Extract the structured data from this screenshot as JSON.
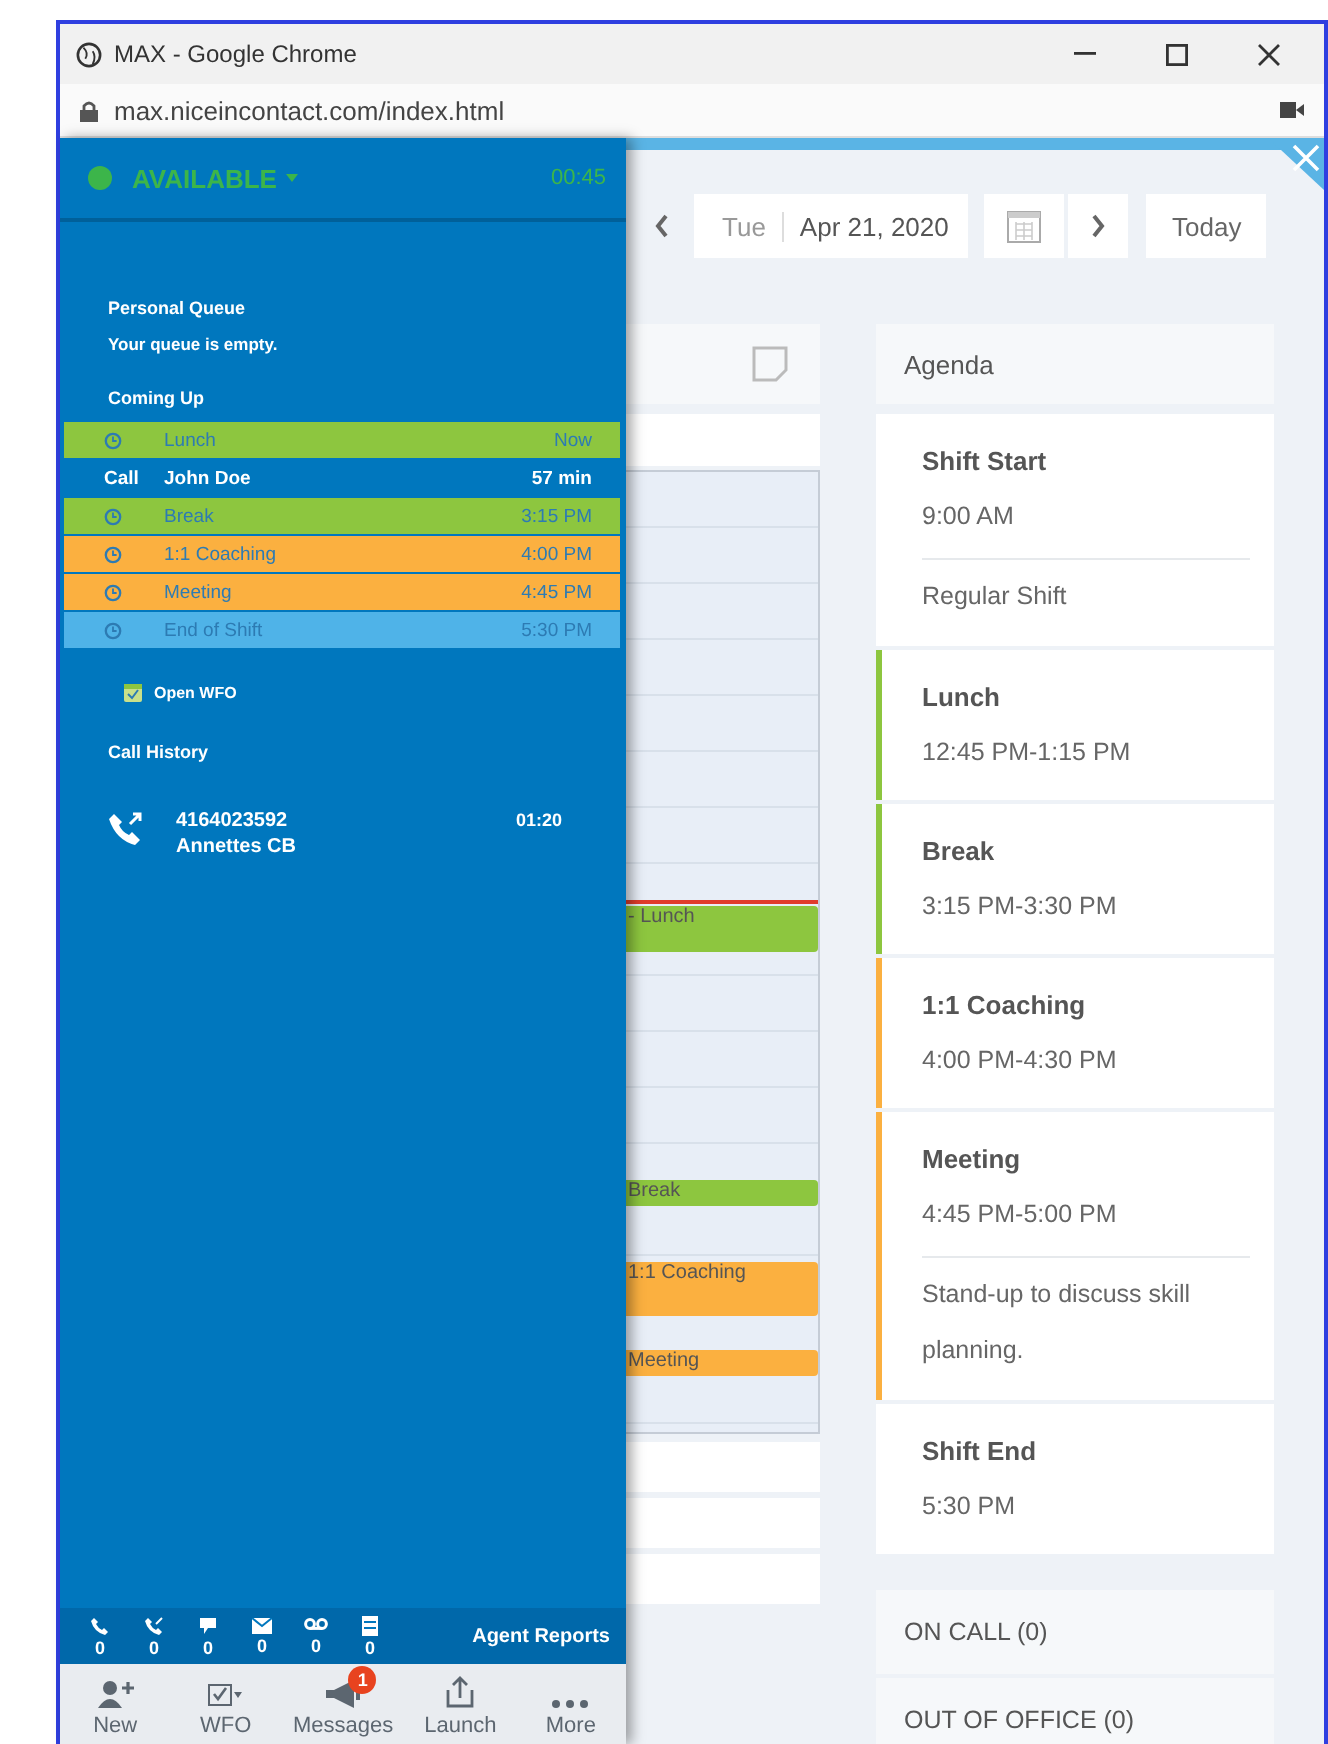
{
  "browser": {
    "title": "MAX - Google Chrome",
    "url": "max.niceincontact.com/index.html"
  },
  "agent_panel": {
    "status": "AVAILABLE",
    "timer": "00:45",
    "personal_queue": {
      "title": "Personal Queue",
      "message": "Your queue is empty."
    },
    "coming_up": {
      "title": "Coming Up",
      "items": [
        {
          "kind": "event",
          "label": "Lunch",
          "time": "Now",
          "color": "#8dc63f"
        },
        {
          "kind": "call",
          "type": "Call",
          "label": "John Doe",
          "time": "57 min"
        },
        {
          "kind": "event",
          "label": "Break",
          "time": "3:15 PM",
          "color": "#8dc63f"
        },
        {
          "kind": "event",
          "label": "1:1 Coaching",
          "time": "4:00 PM",
          "color": "#fbb040"
        },
        {
          "kind": "event",
          "label": "Meeting",
          "time": "4:45 PM",
          "color": "#fbb040"
        },
        {
          "kind": "event",
          "label": "End of Shift",
          "time": "5:30 PM",
          "color": "#4fb3e8"
        }
      ]
    },
    "open_wfo": "Open WFO",
    "call_history": {
      "title": "Call History",
      "calls": [
        {
          "number": "4164023592",
          "name": "Annettes CB",
          "duration": "01:20"
        }
      ]
    },
    "counters": [
      {
        "kind": "phone",
        "count": "0"
      },
      {
        "kind": "callback",
        "count": "0"
      },
      {
        "kind": "chat",
        "count": "0"
      },
      {
        "kind": "email",
        "count": "0"
      },
      {
        "kind": "voicemail",
        "count": "0"
      },
      {
        "kind": "work",
        "count": "0"
      }
    ],
    "agent_reports": "Agent Reports",
    "toolbar": [
      {
        "kind": "new",
        "label": "New"
      },
      {
        "kind": "wfo",
        "label": "WFO"
      },
      {
        "kind": "messages",
        "label": "Messages",
        "badge": "1"
      },
      {
        "kind": "launch",
        "label": "Launch"
      },
      {
        "kind": "more",
        "label": "More"
      }
    ]
  },
  "schedule": {
    "day": "Tue",
    "date": "Apr 21, 2020",
    "today": "Today",
    "calendar_events": [
      {
        "label": "- Lunch",
        "color": "#8dc63f"
      },
      {
        "label": "Break",
        "color": "#8dc63f"
      },
      {
        "label": "1:1 Coaching",
        "color": "#fbb040"
      },
      {
        "label": "Meeting",
        "color": "#fbb040"
      }
    ],
    "agenda": {
      "title": "Agenda",
      "items": [
        {
          "title": "Shift Start",
          "time": "9:00 AM",
          "note": "Regular Shift"
        },
        {
          "title": "Lunch",
          "time": "12:45 PM-1:15 PM",
          "color": "#8dc63f"
        },
        {
          "title": "Break",
          "time": "3:15 PM-3:30 PM",
          "color": "#8dc63f"
        },
        {
          "title": "1:1 Coaching",
          "time": "4:00 PM-4:30 PM",
          "color": "#fbb040"
        },
        {
          "title": "Meeting",
          "time": "4:45 PM-5:00 PM",
          "color": "#fbb040",
          "note": "Stand-up to discuss skill planning."
        },
        {
          "title": "Shift End",
          "time": "5:30 PM"
        }
      ]
    },
    "groups": [
      {
        "label": "ON CALL (0)"
      },
      {
        "label": "OUT OF OFFICE (0)"
      }
    ]
  }
}
